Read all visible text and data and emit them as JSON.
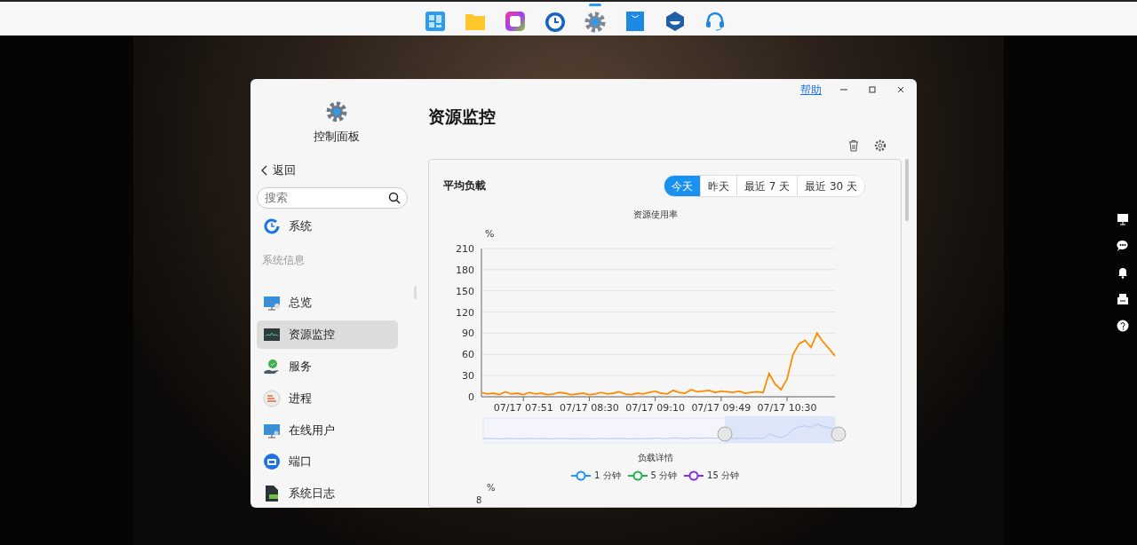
{
  "dock": [
    {
      "active": false
    },
    {
      "active": false
    },
    {
      "active": false
    },
    {
      "active": false
    },
    {
      "active": true
    },
    {
      "active": false
    },
    {
      "active": false
    },
    {
      "active": false
    }
  ],
  "window": {
    "help_link": "帮助"
  },
  "sidebar": {
    "app_title": "控制面板",
    "back": "返回",
    "search": {
      "placeholder": "搜索"
    },
    "top_items": [
      {
        "label": "系统",
        "selected": false
      }
    ],
    "section_title": "系统信息",
    "items": [
      {
        "label": "总览",
        "selected": false
      },
      {
        "label": "资源监控",
        "selected": true
      },
      {
        "label": "服务",
        "selected": false
      },
      {
        "label": "进程",
        "selected": false
      },
      {
        "label": "在线用户",
        "selected": false
      },
      {
        "label": "端口",
        "selected": false
      },
      {
        "label": "系统日志",
        "selected": false
      }
    ]
  },
  "page_title": "资源监控",
  "card": {
    "title": "平均负載",
    "ranges": [
      {
        "label": "今天",
        "selected": true
      },
      {
        "label": "昨天",
        "selected": false
      },
      {
        "label": "最近 7 天",
        "selected": false
      },
      {
        "label": "最近 30 天",
        "selected": false
      }
    ],
    "chart_data": {
      "type": "line",
      "title": "资源使用率",
      "ylabel": "%",
      "grid": true,
      "categories": [
        null,
        null,
        null,
        null,
        null,
        null,
        null,
        "07/17 07:51",
        null,
        null,
        null,
        null,
        null,
        null,
        null,
        null,
        null,
        null,
        "07/17 08:30",
        null,
        null,
        null,
        null,
        null,
        null,
        null,
        null,
        null,
        null,
        "07/17 09:10",
        null,
        null,
        null,
        null,
        null,
        null,
        null,
        null,
        null,
        null,
        "07/17 09:49",
        null,
        null,
        null,
        null,
        null,
        null,
        null,
        null,
        null,
        null,
        "07/17 10:30",
        null,
        null,
        null,
        null,
        null,
        null,
        null,
        null
      ],
      "ylim": [
        0,
        210
      ],
      "yticks": [
        0,
        30,
        60,
        90,
        120,
        150,
        180,
        210
      ],
      "series": [
        {
          "color": "#ff8c00",
          "values": [
            6,
            4,
            5,
            3,
            7,
            4,
            5,
            3,
            6,
            4,
            5,
            3,
            4,
            6,
            5,
            3,
            4,
            5,
            3,
            4,
            6,
            4,
            5,
            7,
            4,
            3,
            5,
            4,
            6,
            8,
            5,
            4,
            9,
            6,
            5,
            10,
            7,
            8,
            9,
            6,
            8,
            7,
            6,
            8,
            5,
            6,
            7,
            6,
            33,
            18,
            10,
            25,
            60,
            75,
            80,
            70,
            90,
            78,
            68,
            58
          ]
        }
      ]
    },
    "legend_title": "负载详情",
    "legend": [
      {
        "label": "1 分钟",
        "color": "#1e90ff"
      },
      {
        "label": "5 分钟",
        "color": "#22b14c"
      },
      {
        "label": "15 分钟",
        "color": "#8a2be2"
      }
    ],
    "second_chart": {
      "ylabel": "%",
      "first_tick": "8"
    }
  }
}
